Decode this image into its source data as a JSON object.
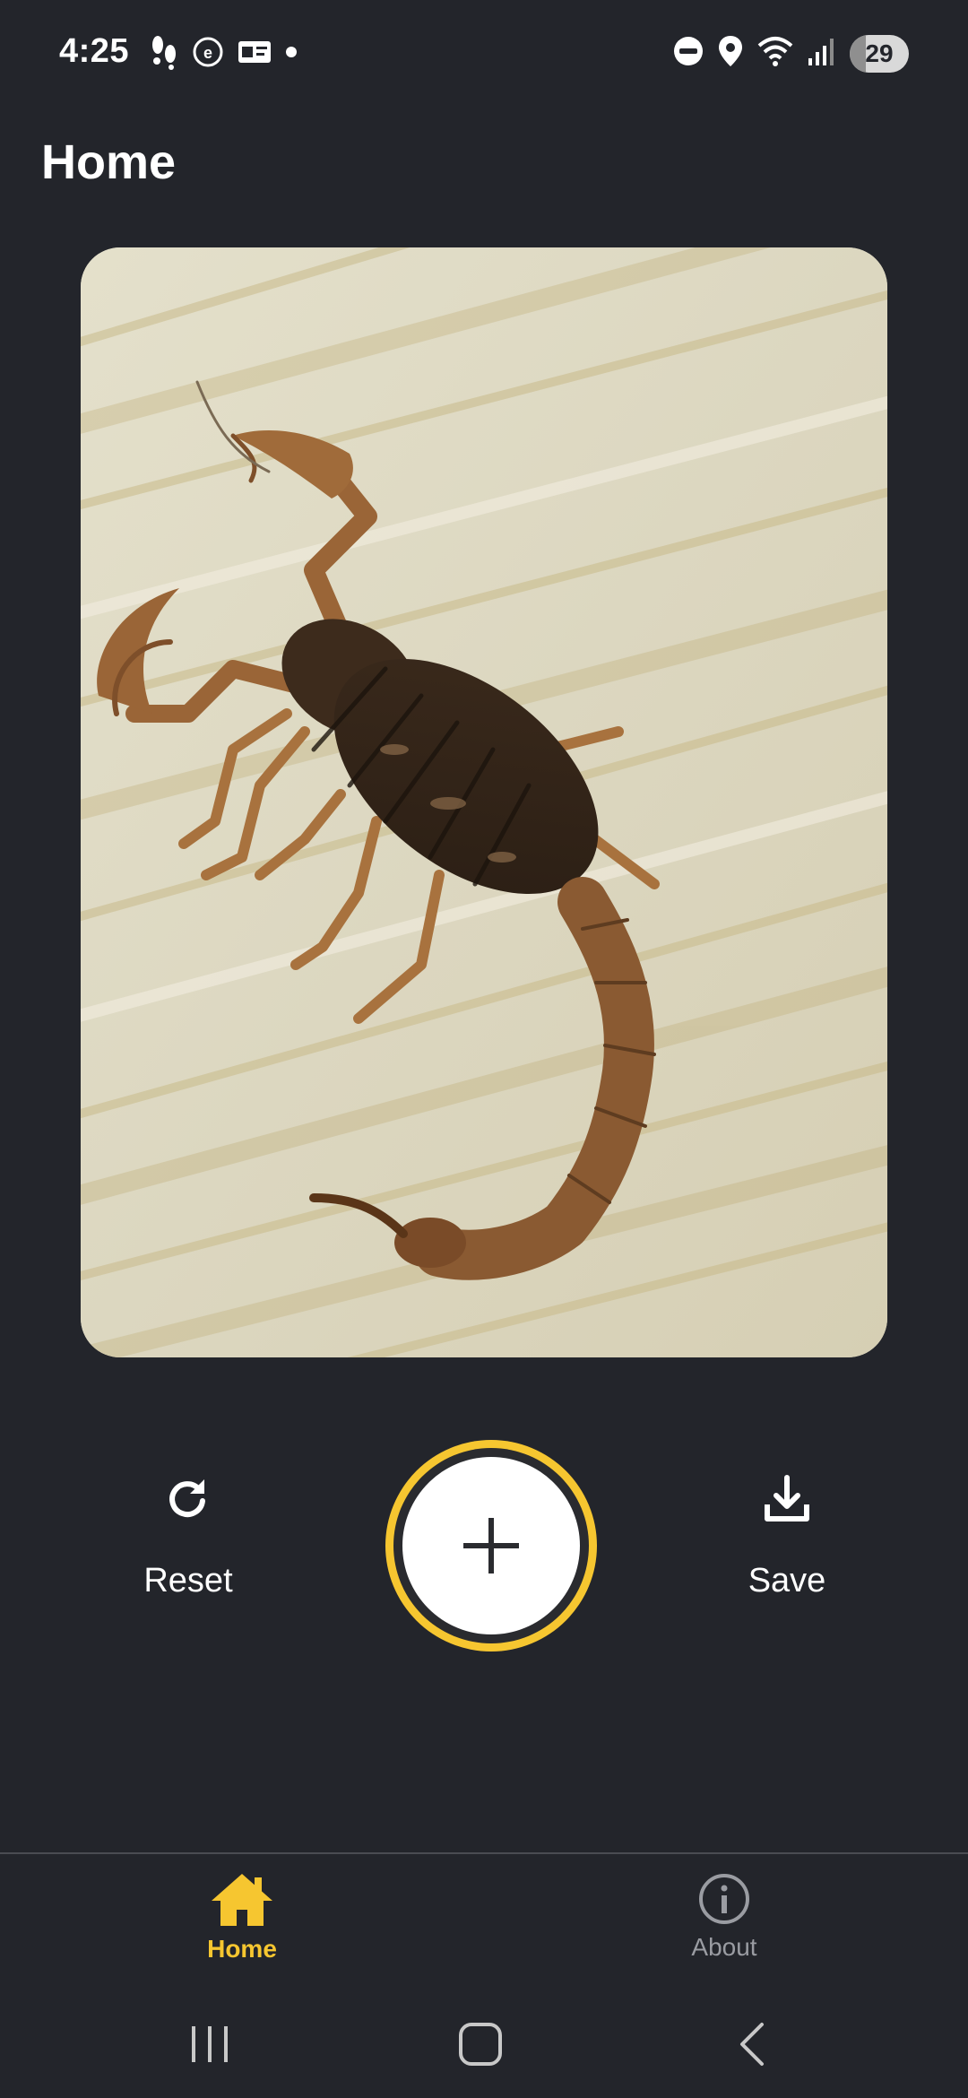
{
  "status_bar": {
    "time": "4:25",
    "battery": "29",
    "left_icons": [
      "steps-icon",
      "vpn-icon",
      "card-icon",
      "dot-icon"
    ],
    "right_icons": [
      "do-not-disturb-icon",
      "location-icon",
      "wifi-icon",
      "signal-icon"
    ]
  },
  "header": {
    "title": "Home"
  },
  "photo": {
    "subject": "scorpion-photo"
  },
  "actions": {
    "reset_label": "Reset",
    "save_label": "Save",
    "add_icon": "plus-icon"
  },
  "bottom_nav": {
    "items": [
      {
        "label": "Home",
        "icon": "home-icon",
        "active": true
      },
      {
        "label": "About",
        "icon": "info-icon",
        "active": false
      }
    ]
  },
  "colors": {
    "background": "#23252b",
    "accent": "#f6c630",
    "inactive": "#9a9ca2",
    "text": "#ffffff"
  }
}
